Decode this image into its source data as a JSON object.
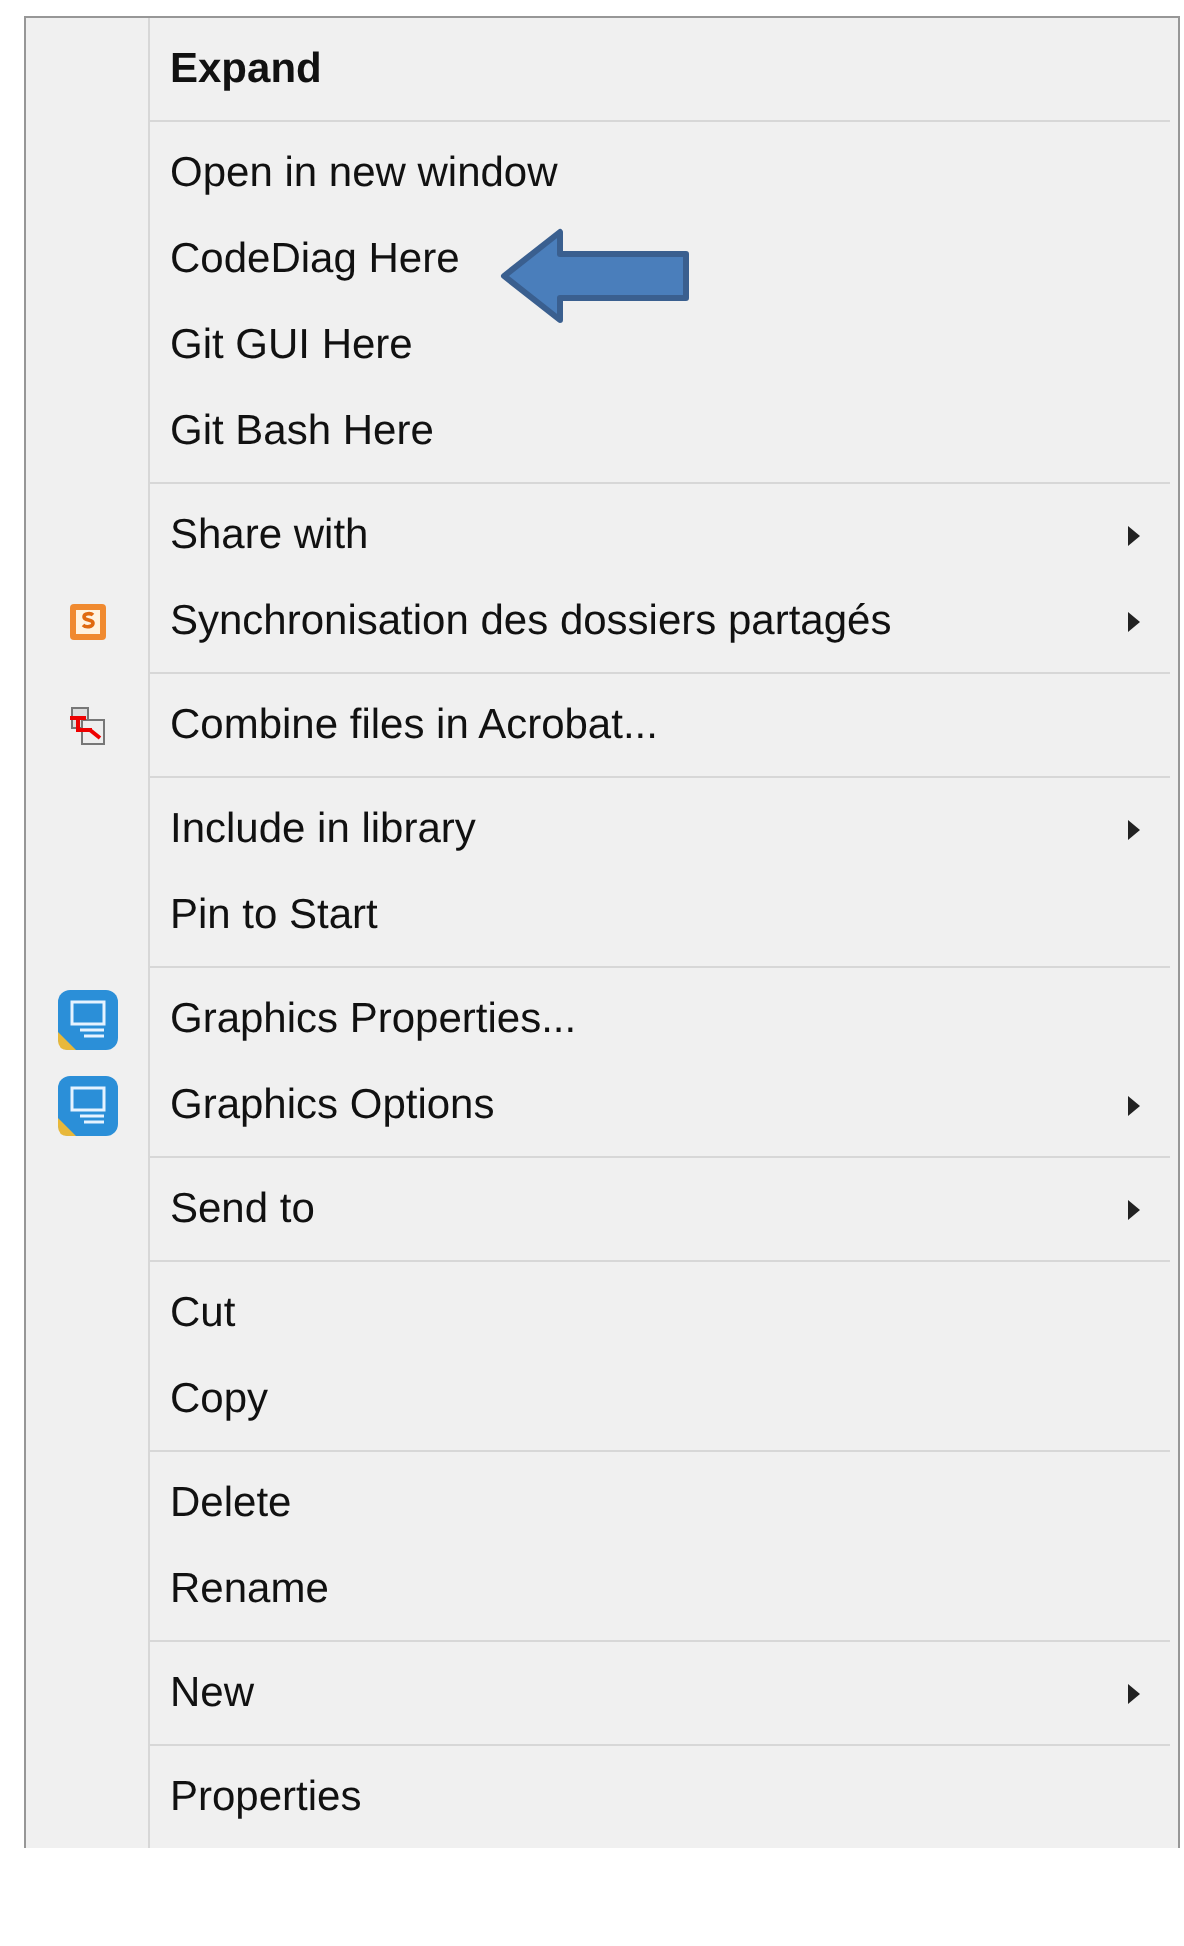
{
  "context_menu": {
    "groups": [
      {
        "items": [
          {
            "label": "Expand",
            "default": true,
            "submenu": false
          }
        ]
      },
      {
        "items": [
          {
            "label": "Open in new window",
            "default": false,
            "submenu": false
          },
          {
            "label": "CodeDiag Here",
            "default": false,
            "submenu": false
          },
          {
            "label": "Git GUI Here",
            "default": false,
            "submenu": false
          },
          {
            "label": "Git Bash Here",
            "default": false,
            "submenu": false
          }
        ]
      },
      {
        "items": [
          {
            "label": "Share with",
            "default": false,
            "submenu": true
          },
          {
            "label": "Synchronisation des dossiers partagés",
            "default": false,
            "submenu": true,
            "kind": "sync"
          }
        ]
      },
      {
        "items": [
          {
            "label": "Combine files in Acrobat...",
            "default": false,
            "submenu": false,
            "kind": "acrobat"
          }
        ]
      },
      {
        "items": [
          {
            "label": "Include in library",
            "default": false,
            "submenu": true
          },
          {
            "label": "Pin to Start",
            "default": false,
            "submenu": false
          }
        ]
      },
      {
        "items": [
          {
            "label": "Graphics Properties...",
            "default": false,
            "submenu": false,
            "kind": "graphics"
          },
          {
            "label": "Graphics Options",
            "default": false,
            "submenu": true,
            "kind": "graphics"
          }
        ]
      },
      {
        "items": [
          {
            "label": "Send to",
            "default": false,
            "submenu": true
          }
        ]
      },
      {
        "items": [
          {
            "label": "Cut",
            "default": false,
            "submenu": false
          },
          {
            "label": "Copy",
            "default": false,
            "submenu": false
          }
        ]
      },
      {
        "items": [
          {
            "label": "Delete",
            "default": false,
            "submenu": false
          },
          {
            "label": "Rename",
            "default": false,
            "submenu": false
          }
        ]
      },
      {
        "items": [
          {
            "label": "New",
            "default": false,
            "submenu": true
          }
        ]
      },
      {
        "items": [
          {
            "label": "Properties",
            "default": false,
            "submenu": false
          }
        ]
      }
    ]
  }
}
